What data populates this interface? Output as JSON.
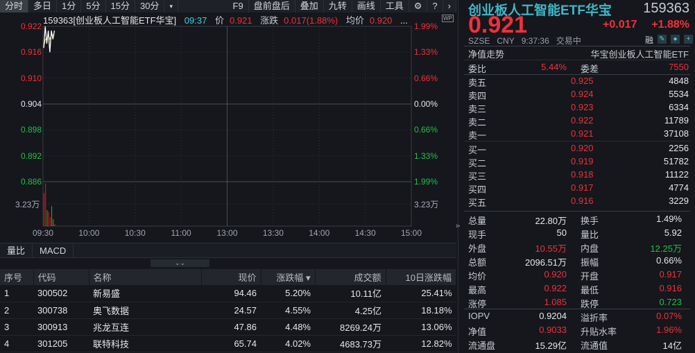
{
  "toolbar": {
    "tabs": [
      "分时",
      "多日",
      "1分",
      "5分",
      "15分",
      "30分"
    ],
    "more": "▾",
    "right": [
      "F9",
      "盘前盘后",
      "叠加",
      "九转",
      "画线",
      "工具"
    ],
    "gear": "⚙",
    "help": "?",
    "next": "›"
  },
  "info": {
    "name": "159363[创业板人工智能ETF华宝]",
    "time": "09:37",
    "price_label": "价",
    "price": "0.921",
    "change_label": "涨跌",
    "change": "0.017(1.88%)",
    "avg_label": "均价",
    "avg": "0.920",
    "ellipsis": "...",
    "wp": "WP"
  },
  "chart_data": {
    "type": "line",
    "title": "分时",
    "prev_close": 0.904,
    "ylim": [
      0.886,
      0.922
    ],
    "y_ticks": [
      "0.922",
      "0.916",
      "0.910",
      "0.904",
      "0.898",
      "0.892",
      "0.886"
    ],
    "y_pct": [
      "1.99%",
      "1.33%",
      "0.66%",
      "0.00%",
      "0.66%",
      "1.33%",
      "1.99%"
    ],
    "x_ticks": [
      "09:30",
      "10:00",
      "10:30",
      "11:00",
      "13:00",
      "13:30",
      "14:00",
      "14:30",
      "15:00"
    ],
    "price": [
      0.917,
      0.922,
      0.918,
      0.921,
      0.916,
      0.921,
      0.919,
      0.921
    ],
    "avg": [
      0.917,
      0.919,
      0.919,
      0.92,
      0.919,
      0.92,
      0.92,
      0.92
    ],
    "volume_label": "3.23万",
    "volume_mid": 3.23,
    "volume": [
      4.8,
      6.2,
      2.3,
      2.1,
      1.3,
      2.9,
      1.0,
      0.3
    ],
    "volume_dir": [
      "up",
      "up",
      "down",
      "up",
      "up",
      "down",
      "down",
      "up"
    ]
  },
  "subtabs": [
    "量比",
    "MACD"
  ],
  "table": {
    "headers": [
      "序号",
      "代码",
      "名称",
      "现价",
      "涨跌幅 ▾",
      "成交额",
      "10日涨跌幅"
    ],
    "rows": [
      [
        "1",
        "300502",
        "新易盛",
        "94.46",
        "5.20%",
        "10.11亿",
        "25.41%"
      ],
      [
        "2",
        "300738",
        "奥飞数据",
        "24.57",
        "4.55%",
        "4.25亿",
        "18.18%"
      ],
      [
        "3",
        "300913",
        "兆龙互连",
        "47.86",
        "4.48%",
        "8269.24万",
        "13.06%"
      ],
      [
        "4",
        "301205",
        "联特科技",
        "65.74",
        "4.02%",
        "4683.73万",
        "12.82%"
      ]
    ]
  },
  "quote": {
    "name": "创业板人工智能ETF华宝",
    "code": "159363",
    "price": "0.921",
    "change": "+0.017",
    "pct": "+1.88%",
    "exchange": "SZSE",
    "currency": "CNY",
    "time": "9:37:36",
    "status": "交易中",
    "rong": "融",
    "nav_label": "净值走势",
    "full_name": "华宝创业板人工智能ETF",
    "wb_label": "委比",
    "wb": "5.44%",
    "wc_label": "委差",
    "wc": "7550",
    "asks": [
      [
        "卖五",
        "0.925",
        "4848"
      ],
      [
        "卖四",
        "0.924",
        "5534"
      ],
      [
        "卖三",
        "0.923",
        "6334"
      ],
      [
        "卖二",
        "0.922",
        "11789"
      ],
      [
        "卖一",
        "0.921",
        "37108"
      ]
    ],
    "bids": [
      [
        "买一",
        "0.920",
        "2256"
      ],
      [
        "买二",
        "0.919",
        "51782"
      ],
      [
        "买三",
        "0.918",
        "11122"
      ],
      [
        "买四",
        "0.917",
        "4774"
      ],
      [
        "买五",
        "0.916",
        "3229"
      ]
    ],
    "stats": [
      [
        "总量",
        "22.80万",
        "white",
        "换手",
        "1.49%",
        "white"
      ],
      [
        "现手",
        "50",
        "white",
        "量比",
        "5.92",
        "white"
      ],
      [
        "外盘",
        "10.55万",
        "red",
        "内盘",
        "12.25万",
        "green"
      ],
      [
        "总额",
        "2096.51万",
        "white",
        "振幅",
        "0.66%",
        "white"
      ],
      [
        "均价",
        "0.920",
        "red",
        "开盘",
        "0.917",
        "red"
      ],
      [
        "最高",
        "0.922",
        "red",
        "最低",
        "0.916",
        "red"
      ],
      [
        "涨停",
        "1.085",
        "red",
        "跌停",
        "0.723",
        "green"
      ]
    ],
    "etf": [
      [
        "IOPV",
        "0.9204",
        "white",
        "溢折率",
        "0.07%",
        "red"
      ],
      [
        "净值",
        "0.9033",
        "red",
        "升贴水率",
        "1.96%",
        "red"
      ],
      [
        "流通盘",
        "15.29亿",
        "white",
        "流通值",
        "14亿",
        "white"
      ]
    ]
  }
}
